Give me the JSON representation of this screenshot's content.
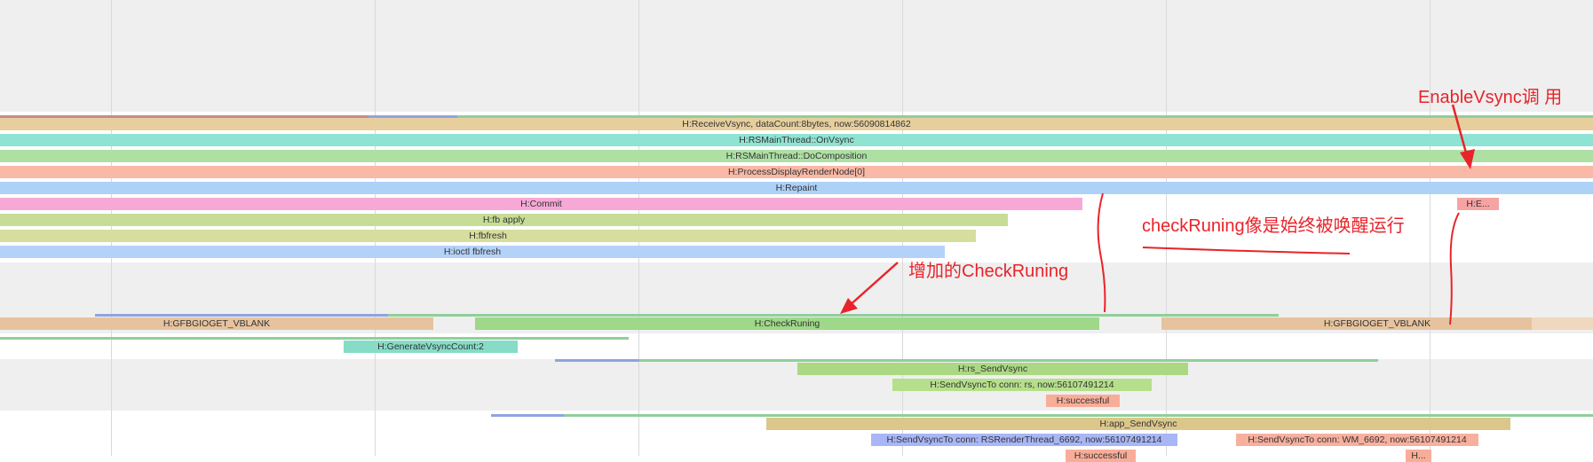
{
  "trace": {
    "rs_main_thread_slices": [
      "H:ReceiveVsync, dataCount:8bytes, now:56090814862",
      "H:RSMainThread::OnVsync",
      "H:RSMainThread::DoComposition",
      "H:ProcessDisplayRenderNode[0]",
      "H:Repaint",
      "H:Commit",
      "H:fb apply",
      "H:fbfresh",
      "H:ioctl fbfresh",
      "H:E..."
    ],
    "vsync_thread_slices": [
      "H:GFBGIOGET_VBLANK",
      "H:CheckRuning",
      "H:GFBGIOGET_VBLANK",
      "H:GenerateVsyncCount:2"
    ],
    "send_vsync_slices": [
      "H:rs_SendVsync",
      "H:SendVsyncTo conn: rs, now:56107491214",
      "H:successful"
    ],
    "app_send_vsync_slices": [
      "H:app_SendVsync",
      "H:SendVsyncTo conn: RSRenderThread_6692, now:56107491214",
      "H:SendVsyncTo conn: WM_6692, now:56107491214",
      "H:successful",
      "H..."
    ]
  },
  "annotations": {
    "enable_vsync": "EnableVsync调 用",
    "check_running_note": "checkRuning像是始终被唤醒运行",
    "added_check": "增加的CheckRuning"
  },
  "colors": {
    "annotation_red": "#e8242a",
    "track_bg": "#efefef",
    "receive_vsync": "#e7cf9d",
    "on_vsync": "#8fe3d3",
    "do_composition": "#aee0a4",
    "process_display": "#f9b9a6",
    "repaint": "#aed1f8",
    "commit": "#f7a8d6",
    "fb_apply": "#c6dd96",
    "fbfresh": "#d7dd9d",
    "ioctl": "#b4d2f8",
    "vblank": "#e6c39e",
    "check_running": "#9ed888",
    "generate_count": "#86dcc6",
    "rs_send": "#aad883",
    "send_to_rs": "#b5df8a",
    "successful": "#f8ad98",
    "app_send": "#dcc78a",
    "send_to_rsrender": "#a9b6f6",
    "send_to_wm": "#f8b09e"
  }
}
